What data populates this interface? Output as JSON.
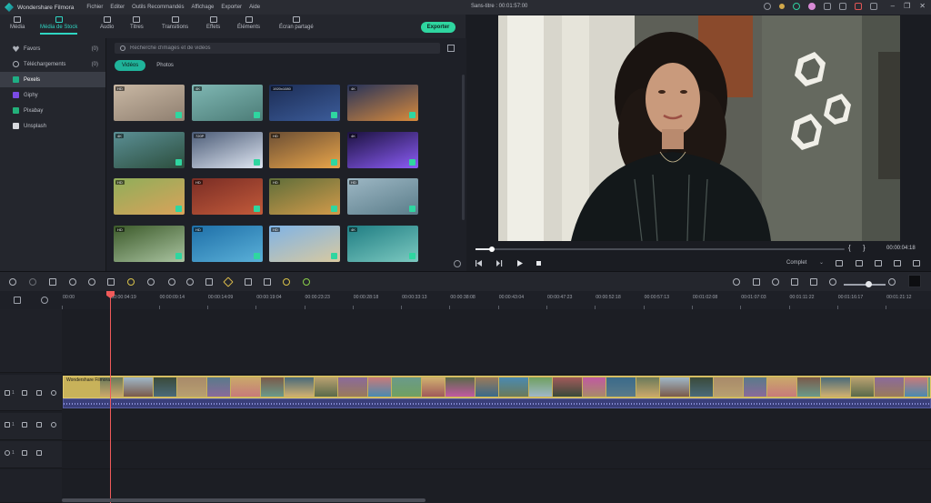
{
  "app": {
    "name": "Wondershare Filmora",
    "menu": [
      "Fichier",
      "Editer",
      "Outils Recommandés",
      "Affichage",
      "Exporter",
      "Aide"
    ],
    "document_title": "Sans-titre : 00:01:57:00"
  },
  "modules": [
    {
      "label": "Média",
      "icon": "folder-icon"
    },
    {
      "label": "Média de Stock",
      "icon": "stock-folder-icon"
    },
    {
      "label": "Audio",
      "icon": "music-note-icon"
    },
    {
      "label": "Titres",
      "icon": "text-title-icon"
    },
    {
      "label": "Transitions",
      "icon": "transition-icon"
    },
    {
      "label": "Effets",
      "icon": "effects-icon"
    },
    {
      "label": "Éléments",
      "icon": "elements-icon"
    },
    {
      "label": "Écran partagé",
      "icon": "split-screen-icon"
    }
  ],
  "export_label": "Exporter",
  "sidebar": {
    "items": [
      {
        "label": "Favors",
        "count": "(0)",
        "icon": "heart-icon"
      },
      {
        "label": "Téléchargements",
        "count": "(0)",
        "icon": "download-icon"
      },
      {
        "label": "Pexels",
        "count": "",
        "icon": "pexels-icon"
      },
      {
        "label": "Giphy",
        "count": "",
        "icon": "giphy-icon"
      },
      {
        "label": "Pixabay",
        "count": "",
        "icon": "pixabay-icon"
      },
      {
        "label": "Unsplash",
        "count": "",
        "icon": "unsplash-icon"
      }
    ],
    "selected": "Pexels"
  },
  "browser": {
    "search_placeholder": "Recherche d'images et de vidéos",
    "tabs": [
      "Vidéos",
      "Photos"
    ],
    "active_tab": "Vidéos",
    "thumbnails": [
      {
        "badge": "HD",
        "colors": [
          "#c9b8a4",
          "#8f7f70"
        ]
      },
      {
        "badge": "4K",
        "colors": [
          "#7fb7b3",
          "#4c7c77"
        ]
      },
      {
        "badge": "1920x1080",
        "colors": [
          "#1c2d55",
          "#3c5c9a"
        ]
      },
      {
        "badge": "4K",
        "colors": [
          "#27335a",
          "#d88a3c"
        ]
      },
      {
        "badge": "4K",
        "colors": [
          "#5b8f95",
          "#2c4e3d"
        ]
      },
      {
        "badge": "720P",
        "colors": [
          "#4c5c77",
          "#dfe6f2"
        ]
      },
      {
        "badge": "HD",
        "colors": [
          "#6b4e34",
          "#e9a54a"
        ]
      },
      {
        "badge": "4K",
        "colors": [
          "#1c1240",
          "#8b5cf6"
        ]
      },
      {
        "badge": "HD",
        "colors": [
          "#8fae5a",
          "#d9a25a"
        ]
      },
      {
        "badge": "HD",
        "colors": [
          "#7a2d25",
          "#c25a3a"
        ]
      },
      {
        "badge": "HD",
        "colors": [
          "#5f6e3a",
          "#d29a4a"
        ]
      },
      {
        "badge": "HD",
        "colors": [
          "#9db7c4",
          "#5b7d8a"
        ]
      },
      {
        "badge": "HD",
        "colors": [
          "#3c5a2a",
          "#a9c3a0"
        ]
      },
      {
        "badge": "HD",
        "colors": [
          "#1e6fa8",
          "#5ab0d8"
        ]
      },
      {
        "badge": "HD",
        "colors": [
          "#7fb3e6",
          "#d8c9a0"
        ]
      },
      {
        "badge": "4K",
        "colors": [
          "#1f7d83",
          "#7cc9c0"
        ]
      }
    ]
  },
  "preview": {
    "timecode": "00:00:04:18",
    "quality": "Complet",
    "progress": 0.045
  },
  "timeline": {
    "ruler_labels": [
      "00:00",
      "00:00:04:19",
      "00:00:09:14",
      "00:00:14:09",
      "00:00:19:04",
      "00:00:23:23",
      "00:00:28:18",
      "00:00:33:13",
      "00:00:38:08",
      "00:00:43:04",
      "00:00:47:23",
      "00:00:52:18",
      "00:00:57:13",
      "00:01:02:08",
      "00:01:07:03",
      "00:01:11:22",
      "00:01:16:17",
      "00:01:21:12"
    ],
    "track_labels": [
      "1",
      "1",
      "1"
    ],
    "clip_name": "Wondershare Filmora"
  },
  "colors": {
    "accent": "#2fd6c3",
    "export": "#2fd6a0",
    "playhead": "#f05a5a",
    "clip": "#c8b25a",
    "audio": "#3a3f7a"
  }
}
